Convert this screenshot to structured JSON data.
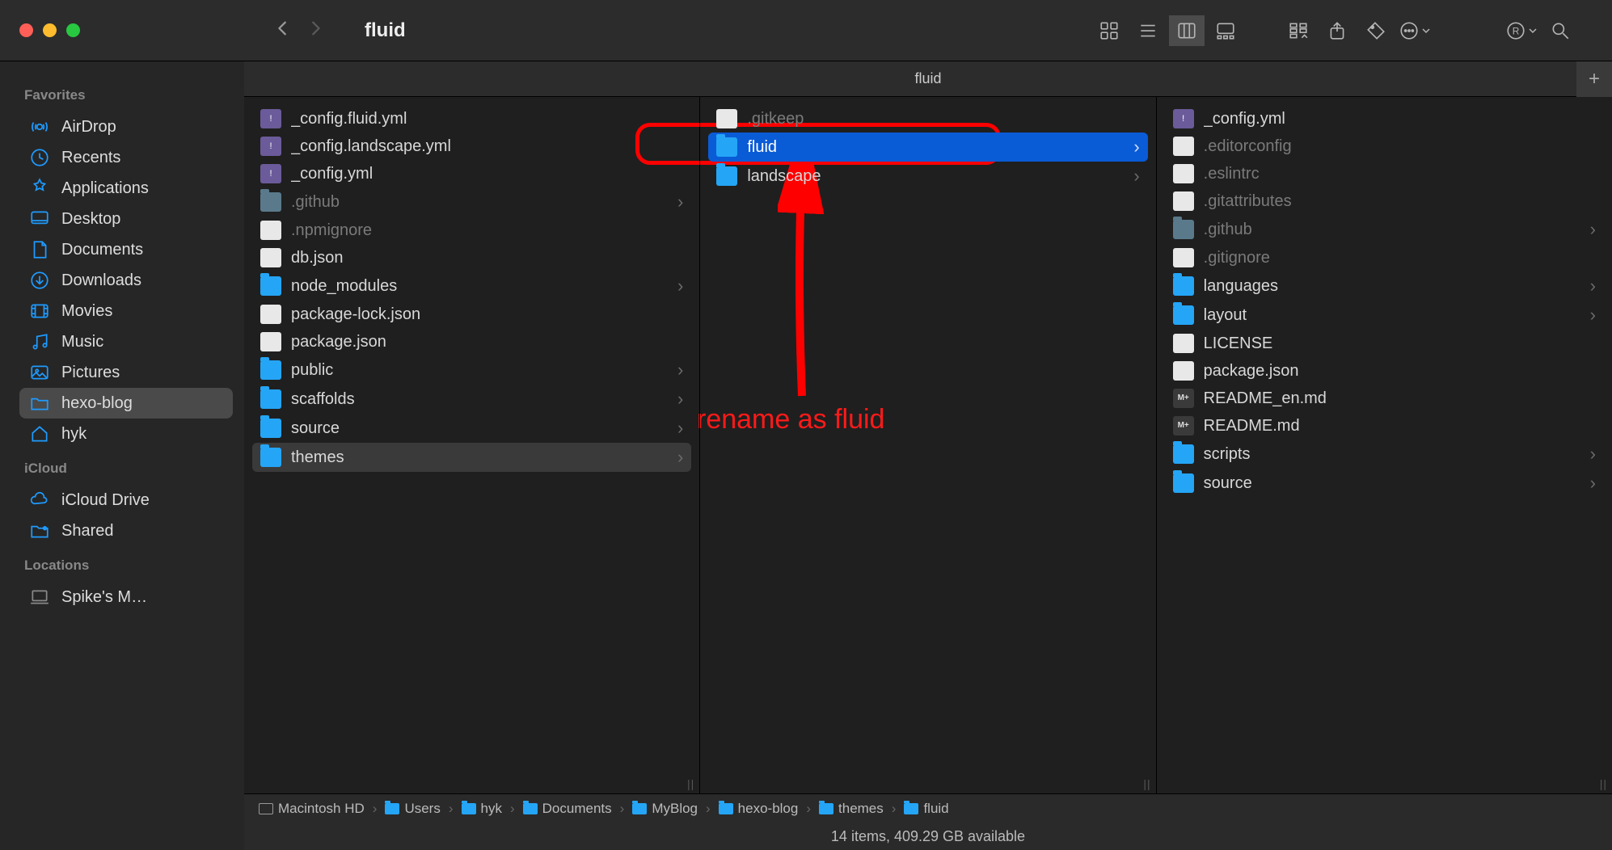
{
  "window": {
    "title": "fluid",
    "tab": "fluid"
  },
  "sidebar": {
    "sections": [
      {
        "title": "Favorites",
        "items": [
          {
            "label": "AirDrop",
            "icon": "airdrop"
          },
          {
            "label": "Recents",
            "icon": "clock"
          },
          {
            "label": "Applications",
            "icon": "apps"
          },
          {
            "label": "Desktop",
            "icon": "desktop"
          },
          {
            "label": "Documents",
            "icon": "doc"
          },
          {
            "label": "Downloads",
            "icon": "download"
          },
          {
            "label": "Movies",
            "icon": "movie"
          },
          {
            "label": "Music",
            "icon": "music"
          },
          {
            "label": "Pictures",
            "icon": "picture"
          },
          {
            "label": "hexo-blog",
            "icon": "folder",
            "selected": true
          },
          {
            "label": "hyk",
            "icon": "home"
          }
        ]
      },
      {
        "title": "iCloud",
        "items": [
          {
            "label": "iCloud Drive",
            "icon": "cloud"
          },
          {
            "label": "Shared",
            "icon": "shared"
          }
        ]
      },
      {
        "title": "Locations",
        "items": [
          {
            "label": "Spike's M…",
            "icon": "laptop",
            "muted": true
          }
        ]
      }
    ]
  },
  "columns": [
    {
      "items": [
        {
          "label": "_config.fluid.yml",
          "type": "file-purple"
        },
        {
          "label": "_config.landscape.yml",
          "type": "file-purple"
        },
        {
          "label": "_config.yml",
          "type": "file-purple"
        },
        {
          "label": ".github",
          "type": "folder-dim",
          "dim": true,
          "chev": true
        },
        {
          "label": ".npmignore",
          "type": "file-white",
          "dim": true
        },
        {
          "label": "db.json",
          "type": "file-white"
        },
        {
          "label": "node_modules",
          "type": "folder",
          "chev": true
        },
        {
          "label": "package-lock.json",
          "type": "file-white"
        },
        {
          "label": "package.json",
          "type": "file-white"
        },
        {
          "label": "public",
          "type": "folder",
          "chev": true
        },
        {
          "label": "scaffolds",
          "type": "folder",
          "chev": true
        },
        {
          "label": "source",
          "type": "folder",
          "chev": true
        },
        {
          "label": "themes",
          "type": "folder",
          "chev": true,
          "colsel": true
        }
      ]
    },
    {
      "items": [
        {
          "label": ".gitkeep",
          "type": "file-white",
          "dim": true
        },
        {
          "label": "fluid",
          "type": "folder",
          "chev": true,
          "selected": true
        },
        {
          "label": "landscape",
          "type": "folder",
          "chev": true
        }
      ]
    },
    {
      "items": [
        {
          "label": "_config.yml",
          "type": "file-purple"
        },
        {
          "label": ".editorconfig",
          "type": "file-white",
          "dim": true
        },
        {
          "label": ".eslintrc",
          "type": "file-white",
          "dim": true
        },
        {
          "label": ".gitattributes",
          "type": "file-white",
          "dim": true
        },
        {
          "label": ".github",
          "type": "folder-dim",
          "dim": true,
          "chev": true
        },
        {
          "label": ".gitignore",
          "type": "file-white",
          "dim": true
        },
        {
          "label": "languages",
          "type": "folder",
          "chev": true
        },
        {
          "label": "layout",
          "type": "folder",
          "chev": true
        },
        {
          "label": "LICENSE",
          "type": "file-white"
        },
        {
          "label": "package.json",
          "type": "file-white"
        },
        {
          "label": "README_en.md",
          "type": "file-md",
          "badge": "M+"
        },
        {
          "label": "README.md",
          "type": "file-md",
          "badge": "M+"
        },
        {
          "label": "scripts",
          "type": "folder",
          "chev": true
        },
        {
          "label": "source",
          "type": "folder",
          "chev": true
        }
      ]
    }
  ],
  "annotation": {
    "text": "rename as fluid"
  },
  "path": [
    "Macintosh HD",
    "Users",
    "hyk",
    "Documents",
    "MyBlog",
    "hexo-blog",
    "themes",
    "fluid"
  ],
  "status": "14 items, 409.29 GB available"
}
